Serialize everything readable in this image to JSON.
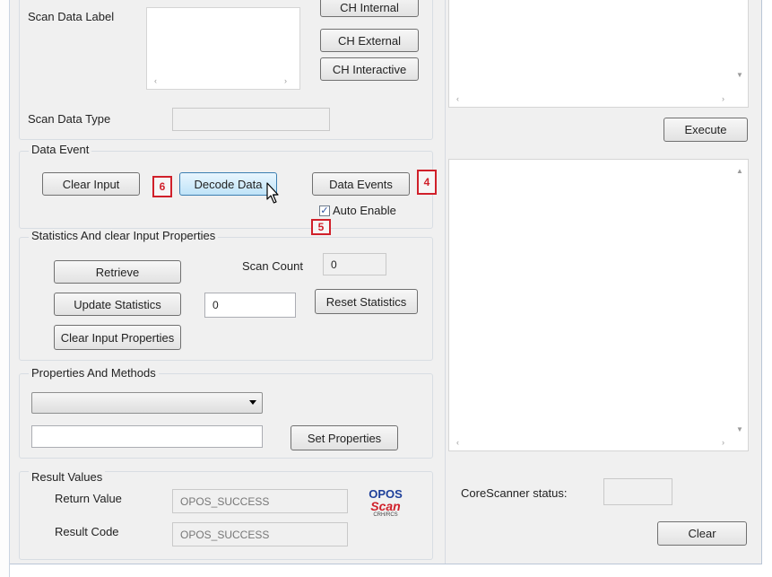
{
  "scan": {
    "label": "Scan Data Label",
    "type_label": "Scan Data Type",
    "type_value": ""
  },
  "buttons": {
    "ch_internal": "CH Internal",
    "ch_external": "CH External",
    "ch_interactive": "CH Interactive",
    "execute": "Execute",
    "clear_right": "Clear"
  },
  "data_event": {
    "title": "Data Event",
    "clear_input": "Clear Input",
    "decode_data": "Decode Data",
    "data_events": "Data Events",
    "auto_enable": "Auto Enable",
    "auto_enable_checked": true
  },
  "markers": {
    "m4": "4",
    "m5": "5",
    "m6": "6"
  },
  "stats": {
    "title": "Statistics And  clear Input Properties",
    "retrieve": "Retrieve",
    "scan_count_label": "Scan Count",
    "scan_count_value": "0",
    "update_statistics": "Update Statistics",
    "update_value": "0",
    "reset_statistics": "Reset Statistics",
    "clear_input_properties": "Clear Input Properties"
  },
  "props": {
    "title": "Properties And Methods",
    "selected": "",
    "value": "",
    "set_properties": "Set Properties"
  },
  "results": {
    "title": "Result Values",
    "return_label": "Return Value",
    "return_value": "OPOS_SUCCESS",
    "code_label": "Result Code",
    "code_value": "OPOS_SUCCESS"
  },
  "logo": {
    "line1": "OPOS",
    "line2": "Scan",
    "line3": "CRH/RCS"
  },
  "status": {
    "label": "CoreScanner status:",
    "value": ""
  },
  "scroll": {
    "left": "‹",
    "right": "›",
    "up": "▲",
    "down": "▼"
  }
}
